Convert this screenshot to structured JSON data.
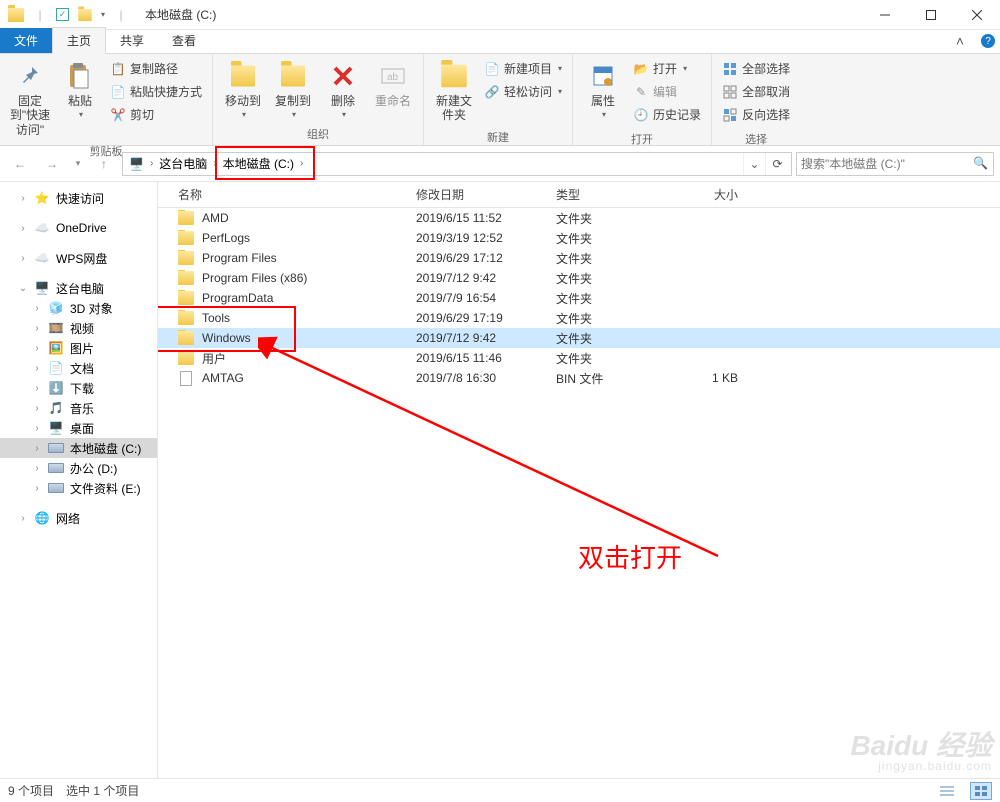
{
  "title": "本地磁盘 (C:)",
  "tabs": {
    "file": "文件",
    "home": "主页",
    "share": "共享",
    "view": "查看"
  },
  "ribbon": {
    "clipboard": {
      "pin": "固定到\"快速访问\"",
      "paste": "粘贴",
      "copy_path": "复制路径",
      "paste_shortcut": "粘贴快捷方式",
      "cut": "剪切",
      "label": "剪贴板"
    },
    "organize": {
      "move_to": "移动到",
      "copy_to": "复制到",
      "delete": "删除",
      "rename": "重命名",
      "label": "组织"
    },
    "new": {
      "new_folder": "新建文件夹",
      "new_item": "新建项目",
      "easy_access": "轻松访问",
      "label": "新建"
    },
    "open": {
      "properties": "属性",
      "open": "打开",
      "edit": "编辑",
      "history": "历史记录",
      "label": "打开"
    },
    "select": {
      "select_all": "全部选择",
      "select_none": "全部取消",
      "invert": "反向选择",
      "label": "选择"
    }
  },
  "breadcrumb": {
    "item1": "这台电脑",
    "item2": "本地磁盘 (C:)"
  },
  "search": {
    "placeholder": "搜索\"本地磁盘 (C:)\""
  },
  "nav": {
    "quick": "快速访问",
    "onedrive": "OneDrive",
    "wps": "WPS网盘",
    "thispc": "这台电脑",
    "3d": "3D 对象",
    "videos": "视频",
    "pictures": "图片",
    "documents": "文档",
    "downloads": "下载",
    "music": "音乐",
    "desktop": "桌面",
    "c": "本地磁盘 (C:)",
    "d": "办公 (D:)",
    "e": "文件资料 (E:)",
    "network": "网络"
  },
  "columns": {
    "name": "名称",
    "date": "修改日期",
    "type": "类型",
    "size": "大小"
  },
  "files": [
    {
      "name": "AMD",
      "date": "2019/6/15 11:52",
      "type": "文件夹",
      "size": "",
      "icon": "folder"
    },
    {
      "name": "PerfLogs",
      "date": "2019/3/19 12:52",
      "type": "文件夹",
      "size": "",
      "icon": "folder"
    },
    {
      "name": "Program Files",
      "date": "2019/6/29 17:12",
      "type": "文件夹",
      "size": "",
      "icon": "folder"
    },
    {
      "name": "Program Files (x86)",
      "date": "2019/7/12 9:42",
      "type": "文件夹",
      "size": "",
      "icon": "folder"
    },
    {
      "name": "ProgramData",
      "date": "2019/7/9 16:54",
      "type": "文件夹",
      "size": "",
      "icon": "folder"
    },
    {
      "name": "Tools",
      "date": "2019/6/29 17:19",
      "type": "文件夹",
      "size": "",
      "icon": "folder"
    },
    {
      "name": "Windows",
      "date": "2019/7/12 9:42",
      "type": "文件夹",
      "size": "",
      "icon": "folder",
      "selected": true
    },
    {
      "name": "用户",
      "date": "2019/6/15 11:46",
      "type": "文件夹",
      "size": "",
      "icon": "folder"
    },
    {
      "name": "AMTAG",
      "date": "2019/7/8 16:30",
      "type": "BIN 文件",
      "size": "1 KB",
      "icon": "file"
    }
  ],
  "status": {
    "count": "9 个项目",
    "selection": "选中 1 个项目"
  },
  "annotation": {
    "label": "双击打开"
  },
  "watermark": {
    "main": "Baidu 经验",
    "sub": "jingyan.baidu.com"
  }
}
